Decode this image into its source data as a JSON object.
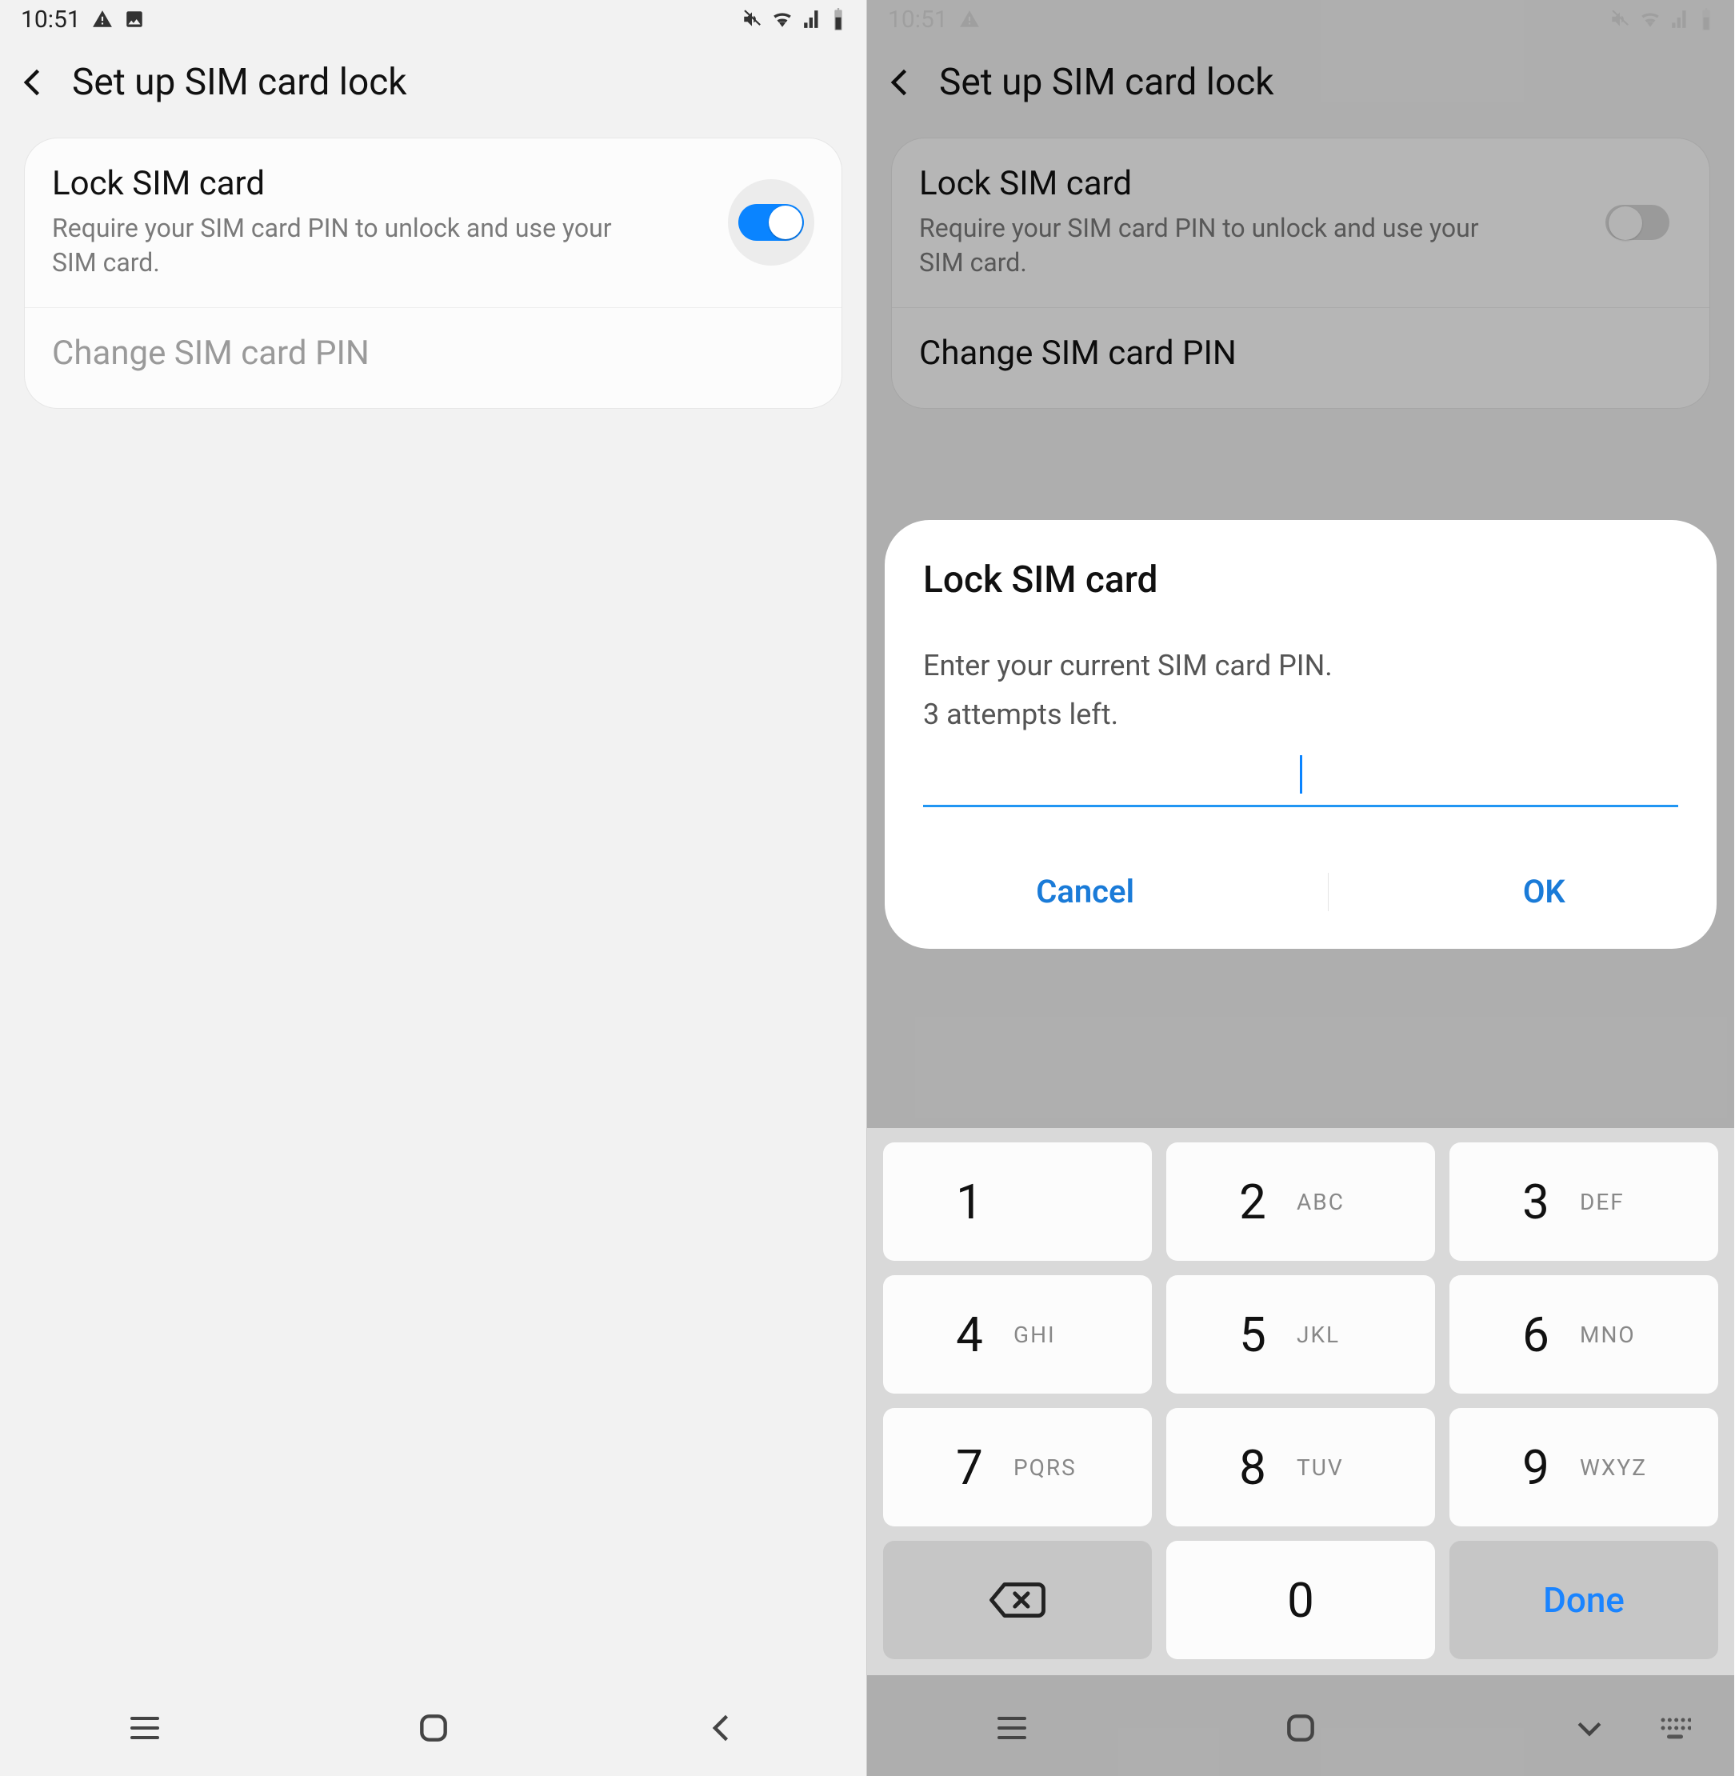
{
  "status": {
    "time": "10:51"
  },
  "appbar": {
    "title": "Set up SIM card lock"
  },
  "settings": {
    "lock_title": "Lock SIM card",
    "lock_sub": "Require your SIM card PIN to unlock and use your SIM card.",
    "change_pin": "Change SIM card PIN"
  },
  "dialog": {
    "title": "Lock SIM card",
    "line1": "Enter your current SIM card PIN.",
    "line2": "3 attempts left.",
    "cancel": "Cancel",
    "ok": "OK"
  },
  "keypad": {
    "keys": [
      {
        "num": "1",
        "letters": ""
      },
      {
        "num": "2",
        "letters": "ABC"
      },
      {
        "num": "3",
        "letters": "DEF"
      },
      {
        "num": "4",
        "letters": "GHI"
      },
      {
        "num": "5",
        "letters": "JKL"
      },
      {
        "num": "6",
        "letters": "MNO"
      },
      {
        "num": "7",
        "letters": "PQRS"
      },
      {
        "num": "8",
        "letters": "TUV"
      },
      {
        "num": "9",
        "letters": "WXYZ"
      }
    ],
    "zero": "0",
    "done": "Done"
  }
}
